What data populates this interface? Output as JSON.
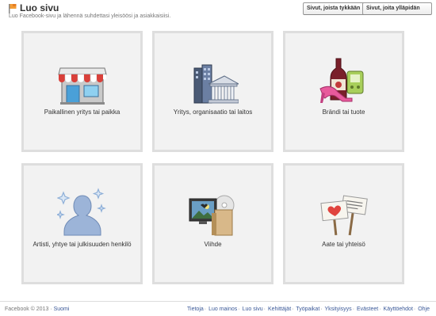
{
  "header": {
    "title": "Luo sivu",
    "subtitle": "Luo Facebook-sivu ja lähennä suhdettasi yleisöösi ja asiakkaisiisi.",
    "liked_pages_button": "Sivut, joista tykkään",
    "admin_pages_button": "Sivut, joita ylläpidän"
  },
  "categories": [
    {
      "label": "Paikallinen yritys tai paikka",
      "icon": "storefront-icon"
    },
    {
      "label": "Yritys, organisaatio tai laitos",
      "icon": "office-building-icon"
    },
    {
      "label": "Brändi tai tuote",
      "icon": "products-icon"
    },
    {
      "label": "Artisti, yhtye tai julkisuuden henkilö",
      "icon": "person-sparkle-icon"
    },
    {
      "label": "Viihde",
      "icon": "entertainment-icon"
    },
    {
      "label": "Aate tai yhteisö",
      "icon": "protest-signs-icon"
    }
  ],
  "footer": {
    "copyright": "Facebook © 2013 ·",
    "language": "Suomi",
    "links": [
      "Tietoja",
      "Luo mainos",
      "Luo sivu",
      "Kehittäjät",
      "Työpaikat",
      "Yksityisyys",
      "Evästeet",
      "Käyttöehdot",
      "Ohje"
    ]
  },
  "colors": {
    "link": "#3b5998",
    "tile_bg": "#f2f2f2",
    "tile_border": "#dedede"
  }
}
